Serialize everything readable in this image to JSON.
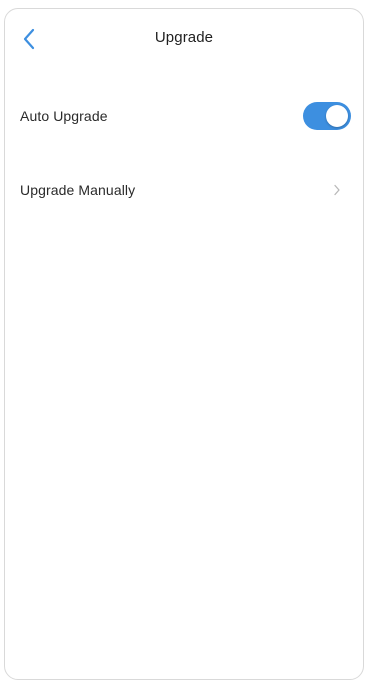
{
  "header": {
    "title": "Upgrade",
    "back_icon": "chevron-left-icon"
  },
  "settings": {
    "auto_upgrade": {
      "label": "Auto Upgrade",
      "enabled": true
    },
    "upgrade_manually": {
      "label": "Upgrade Manually",
      "icon": "chevron-right-icon"
    }
  },
  "colors": {
    "accent": "#3d8fe0",
    "back_icon": "#3d8fe0",
    "chevron": "#b8b8b8",
    "border": "#d9d9d9"
  }
}
